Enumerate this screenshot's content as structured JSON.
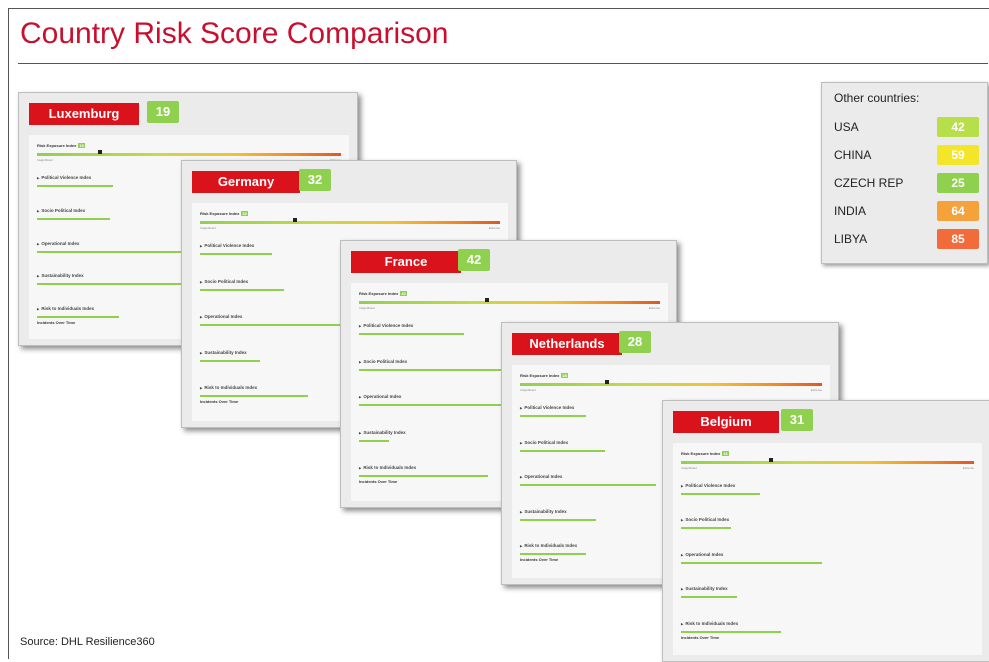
{
  "title": "Country Risk Score Comparison",
  "source": "Source: DHL Resilience360",
  "card_labels": {
    "rei": "Risk Exposure Index",
    "low": "Insignificant",
    "high": "Extreme",
    "incidents": "Incidents Over Time",
    "indices": [
      "Political Violence Index",
      "Socio Political Index",
      "Operational Index",
      "Sustainability Index",
      "Risk to Individuals Index"
    ]
  },
  "countries": [
    {
      "name": "Luxemburg",
      "score": "19"
    },
    {
      "name": "Germany",
      "score": "32"
    },
    {
      "name": "France",
      "score": "42"
    },
    {
      "name": "Netherlands",
      "score": "28"
    },
    {
      "name": "Belgium",
      "score": "31"
    }
  ],
  "other": {
    "header": "Other countries:",
    "items": [
      {
        "name": "USA",
        "score": "42",
        "color": "#b7df4a"
      },
      {
        "name": "CHINA",
        "score": "59",
        "color": "#f2e52a"
      },
      {
        "name": "CZECH REP",
        "score": "25",
        "color": "#8fd14f"
      },
      {
        "name": "INDIA",
        "score": "64",
        "color": "#f5a23a"
      },
      {
        "name": "LIBYA",
        "score": "85",
        "color": "#f26b3a"
      }
    ]
  },
  "colors": {
    "accent": "#c8102e",
    "badge_green": "#8fd14f",
    "name_red": "#d9121b"
  }
}
